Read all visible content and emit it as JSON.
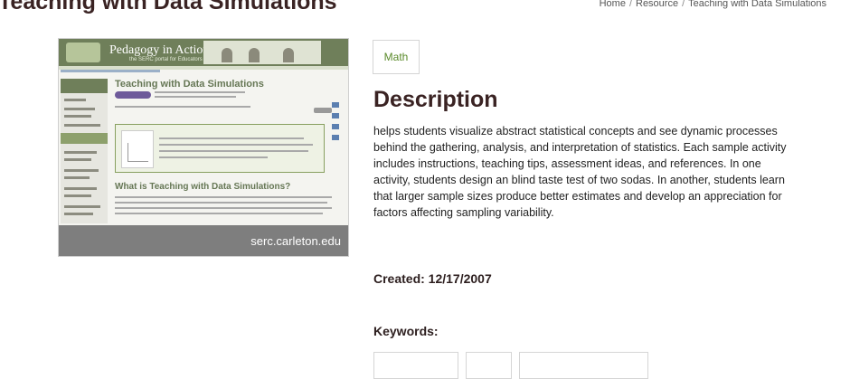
{
  "page": {
    "title": "Teaching with Data Simulations"
  },
  "breadcrumb": {
    "items": [
      "Home",
      "Resource",
      "Teaching with Data Simulations"
    ],
    "separator": "/"
  },
  "thumbnail": {
    "site_logo": "Pedagogy in Action",
    "site_tagline": "the SERC portal for Educators",
    "page_heading": "Teaching with Data Simulations",
    "section_heading": "What is Teaching with Data Simulations?",
    "caption": "serc.carleton.edu"
  },
  "tag": {
    "label": "Math",
    "color": "#5a8a2a"
  },
  "description": {
    "heading": "Description",
    "text": "helps students visualize abstract statistical concepts and see dynamic processes behind the gathering, analysis, and interpretation of statistics. Each sample activity includes instructions, teaching tips, assessment ideas, and references. In one activity, students design an blind taste test of two sodas. In another, students learn that larger sample sizes produce better estimates and develop an appreciation for factors affecting sampling variability."
  },
  "created": {
    "label": "Created: 12/17/2007"
  },
  "keywords": {
    "label": "Keywords:"
  }
}
